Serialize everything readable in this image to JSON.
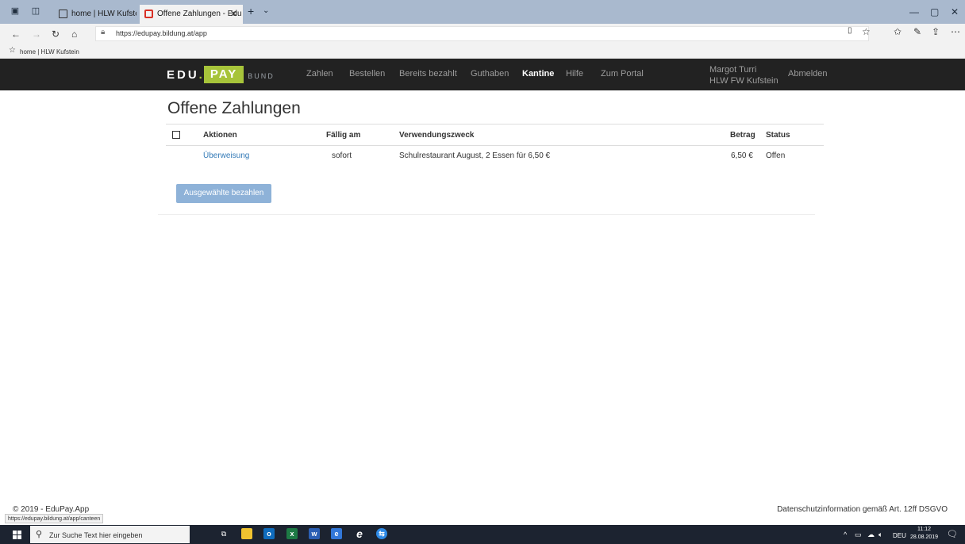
{
  "browser": {
    "tabs": [
      {
        "title": "home | HLW Kufstein"
      },
      {
        "title": "Offene Zahlungen - Edu"
      }
    ],
    "new_tab_label": "+",
    "url": "https://edupay.bildung.at/app",
    "favorites": [
      {
        "label": "home | HLW Kufstein"
      }
    ],
    "status_url": "https://edupay.bildung.at/app/canteen"
  },
  "nav": {
    "logo": {
      "edu": "EDU",
      "dot": ".",
      "pay": "PAY",
      "bund": "BUND"
    },
    "items": [
      {
        "label": "Zahlen"
      },
      {
        "label": "Bestellen"
      },
      {
        "label": "Bereits bezahlt"
      },
      {
        "label": "Guthaben"
      },
      {
        "label": "Kantine"
      },
      {
        "label": "Hilfe"
      },
      {
        "label": "Zum Portal"
      }
    ],
    "user_name": "Margot Turri",
    "user_school": "HLW FW Kufstein",
    "logout": "Abmelden"
  },
  "page": {
    "title": "Offene Zahlungen",
    "columns": [
      "Aktionen",
      "Fällig am",
      "Verwendungszweck",
      "Betrag",
      "Status"
    ],
    "rows": [
      {
        "action": "Überweisung",
        "due": "sofort",
        "purpose": "Schulrestaurant August, 2 Essen für 6,50 €",
        "amount": "6,50 €",
        "status": "Offen"
      }
    ],
    "pay_button": "Ausgewählte bezahlen"
  },
  "footer": {
    "copyright": "© 2019 - EduPay.App",
    "privacy": "Datenschutzinformation gemäß Art. 12ff DSGVO"
  },
  "taskbar": {
    "search_placeholder": "Zur Suche Text hier eingeben",
    "language": "DEU",
    "time": "11:12",
    "date": "28.08.2019"
  },
  "colors": {
    "nav_bg": "#222222",
    "accent": "#a7c43a",
    "link": "#337ab7",
    "button": "#8eb2d8"
  }
}
